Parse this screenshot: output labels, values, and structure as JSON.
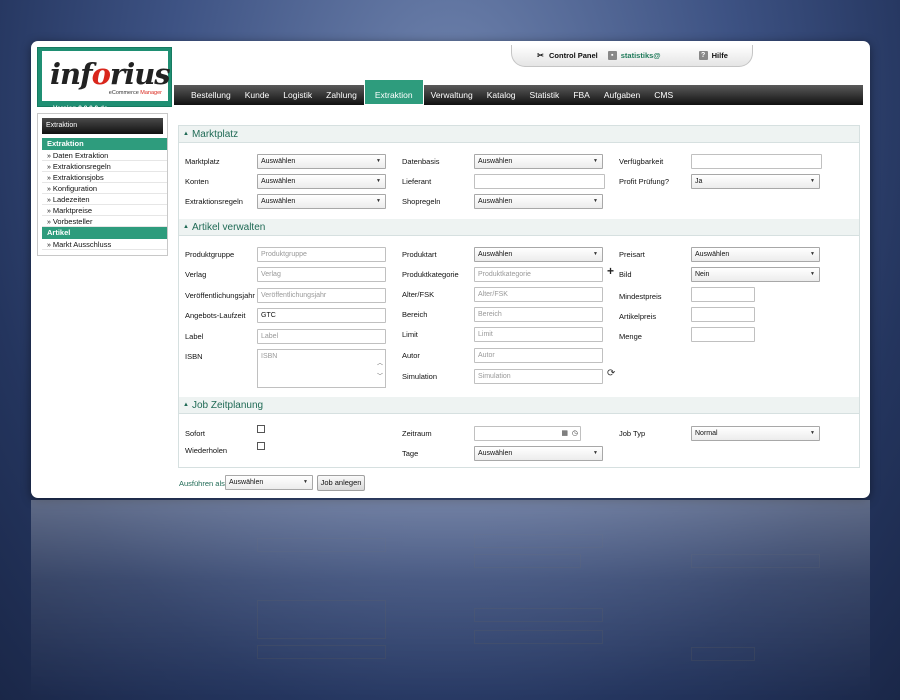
{
  "logo": {
    "main": "inforius",
    "sub": "eCommerce",
    "sub_em": "Manager",
    "version": "Version 9.0.0.0 de"
  },
  "toptab": {
    "control_panel": "Control Panel",
    "user": "statistiks@",
    "help": "Hilfe"
  },
  "nav": [
    "Bestellung",
    "Kunde",
    "Logistik",
    "Zahlung",
    "Extraktion",
    "Verwaltung",
    "Katalog",
    "Statistik",
    "FBA",
    "Aufgaben",
    "CMS"
  ],
  "sidebar": {
    "title": "Extraktion",
    "group1": "Extraktion",
    "items1": [
      "Daten Extraktion",
      "Extraktionsregeln",
      "Extraktionsjobs",
      "Konfiguration",
      "Ladezeiten",
      "Marktpreise",
      "Vorbesteller"
    ],
    "group2": "Artikel",
    "items2": [
      "Markt Ausschluss"
    ]
  },
  "sections": {
    "marktplatz": "Marktplatz",
    "artikel": "Artikel verwalten",
    "job": "Job Zeitplanung"
  },
  "marktplatz": {
    "marktplatz_label": "Marktplatz",
    "marktplatz_value": "Auswählen",
    "konten_label": "Konten",
    "konten_value": "Auswählen",
    "extraktionsregeln_label": "Extraktionsregeln",
    "extraktionsregeln_value": "Auswählen",
    "datenbasis_label": "Datenbasis",
    "datenbasis_value": "Auswählen",
    "lieferant_label": "Lieferant",
    "shopregeln_label": "Shopregeln",
    "shopregeln_value": "Auswählen",
    "verfuegbarkeit_label": "Verfügbarkeit",
    "profit_label": "Profit Prüfung?",
    "profit_value": "Ja"
  },
  "artikel": {
    "produktgruppe_label": "Produktgruppe",
    "produktgruppe_ph": "Produktgruppe",
    "verlag_label": "Verlag",
    "verlag_ph": "Verlag",
    "vj_label": "Veröffentlichungsjahr",
    "vj_ph": "Veröffentlichungsjahr",
    "laufzeit_label": "Angebots-Laufzeit",
    "laufzeit_value": "GTC",
    "label_label": "Label",
    "label_ph": "Label",
    "isbn_label": "ISBN",
    "isbn_ph": "ISBN",
    "produktart_label": "Produktart",
    "produktart_value": "Auswählen",
    "produktkategorie_label": "Produktkategorie",
    "produktkategorie_ph": "Produktkategorie",
    "alter_label": "Alter/FSK",
    "alter_ph": "Alter/FSK",
    "bereich_label": "Bereich",
    "bereich_ph": "Bereich",
    "limit_label": "Limit",
    "limit_ph": "Limit",
    "autor_label": "Autor",
    "autor_ph": "Autor",
    "simulation_label": "Simulation",
    "simulation_ph": "Simulation",
    "preisart_label": "Preisart",
    "preisart_value": "Auswählen",
    "bild_label": "Bild",
    "bild_value": "Nein",
    "mindestpreis_label": "Mindestpreis",
    "artikelpreis_label": "Artikelpreis",
    "menge_label": "Menge"
  },
  "job": {
    "sofort_label": "Sofort",
    "wiederholen_label": "Wiederholen",
    "zeitraum_label": "Zeitraum",
    "tage_label": "Tage",
    "tage_value": "Auswählen",
    "jobtyp_label": "Job Typ",
    "jobtyp_value": "Normal"
  },
  "footer": {
    "ausfuehren_label": "Ausführen als",
    "ausfuehren_value": "Auswählen",
    "job_button": "Job anlegen"
  },
  "colors": {
    "accent": "#2e9c7d",
    "background": "#3d5283"
  }
}
